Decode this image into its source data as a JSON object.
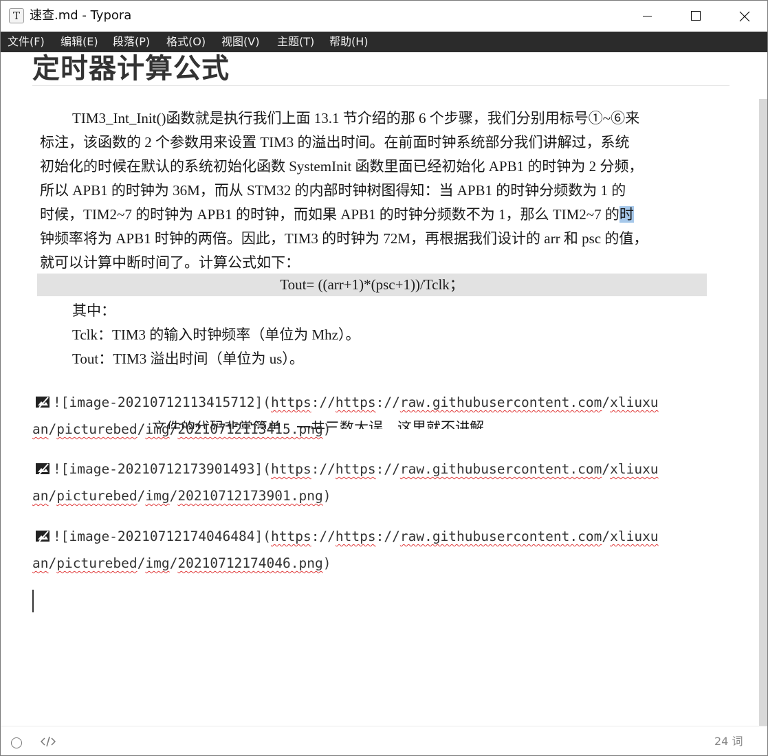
{
  "window": {
    "title": "速查.md - Typora",
    "app_icon_letter": "T"
  },
  "menu": {
    "items": [
      "文件(F)",
      "编辑(E)",
      "段落(P)",
      "格式(O)",
      "视图(V)",
      "主题(T)",
      "帮助(H)"
    ]
  },
  "document": {
    "heading": "定时器计算公式",
    "image_text": {
      "lines": [
        "TIM3_Int_Init()函数就是执行我们上面 13.1 节介绍的那 6 个步骤，我们分别用标号①~⑥来",
        "标注，该函数的 2 个参数用来设置 TIM3 的溢出时间。在前面时钟系统部分我们讲解过，系统",
        "初始化的时候在默认的系统初始化函数 SystemInit 函数里面已经初始化 APB1 的时钟为 2 分频，",
        "所以 APB1 的时钟为 36M，而从 STM32 的内部时钟树图得知：当 APB1 的时钟分频数为 1 的",
        "时候，TIM2~7 的时钟为 APB1 的时钟，而如果 APB1 的时钟分频数不为 1，那么 TIM2~7 的",
        "钟频率将为 APB1 时钟的两倍。因此，TIM3 的时钟为 72M，再根据我们设计的 arr 和 psc 的值，",
        "就可以计算中断时间了。计算公式如下："
      ],
      "selected_char": "时",
      "formula": "Tout= ((arr+1)*(psc+1))/Tclk；",
      "where": "其中：",
      "tclk": "Tclk：TIM3 的输入时钟频率（单位为 Mhz）。",
      "tout": "Tout：TIM3 溢出时间（单位为 us）。",
      "cut_line": "文件的代码非常简单，一共三数大误，这里就不讲解"
    },
    "markdown_images": [
      {
        "prefix": "![image-20210712113415712](",
        "l1_a": "https",
        "l1_b": "://",
        "l1_c": "https",
        "l1_d": "://",
        "l1_e": "raw.githubusercontent.com",
        "l1_f": "/",
        "l1_g": "xliuxu",
        "l2_a": "an",
        "l2_b": "/",
        "l2_c": "picturebed",
        "l2_d": "/",
        "l2_e": "img",
        "l2_f": "/",
        "l2_g": "20210712113415.png",
        "l2_h": ")"
      },
      {
        "prefix": "![image-20210712173901493](",
        "l1_a": "https",
        "l1_b": "://",
        "l1_c": "https",
        "l1_d": "://",
        "l1_e": "raw.githubusercontent.com",
        "l1_f": "/",
        "l1_g": "xliuxu",
        "l2_a": "an",
        "l2_b": "/",
        "l2_c": "picturebed",
        "l2_d": "/",
        "l2_e": "img",
        "l2_f": "/",
        "l2_g": "20210712173901.png",
        "l2_h": ")"
      },
      {
        "prefix": "![image-20210712174046484](",
        "l1_a": "https",
        "l1_b": "://",
        "l1_c": "https",
        "l1_d": "://",
        "l1_e": "raw.githubusercontent.com",
        "l1_f": "/",
        "l1_g": "xliuxu",
        "l2_a": "an",
        "l2_b": "/",
        "l2_c": "picturebed",
        "l2_d": "/",
        "l2_e": "img",
        "l2_f": "/",
        "l2_g": "20210712174046.png",
        "l2_h": ")"
      }
    ]
  },
  "statusbar": {
    "word_count": "24 词",
    "icons": [
      "outline-circle-icon",
      "source-code-icon"
    ]
  },
  "colors": {
    "menubar_bg": "#2b2b2b",
    "selection": "#a6c8ea",
    "formula_band": "#e2e2e2",
    "spell_error": "#e03a3a"
  }
}
